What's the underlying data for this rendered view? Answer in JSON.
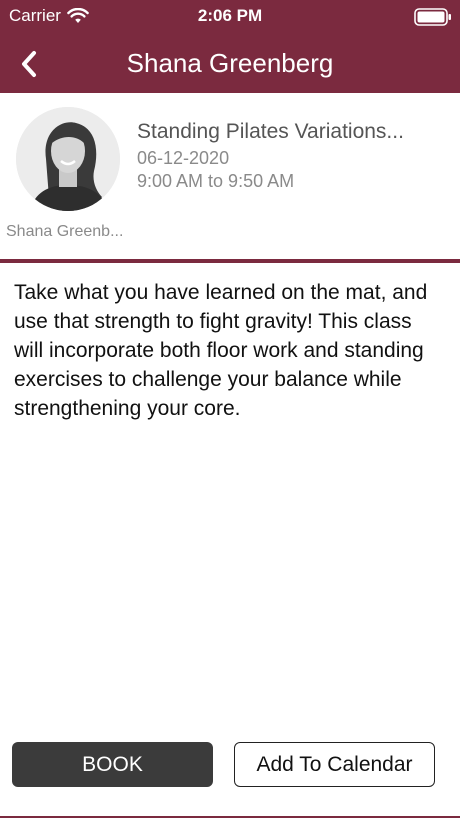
{
  "status_bar": {
    "carrier": "Carrier",
    "time": "2:06 PM"
  },
  "nav": {
    "title": "Shana Greenberg"
  },
  "class_info": {
    "title": "Standing Pilates Variations...",
    "date": "06-12-2020",
    "time": "9:00 AM to 9:50 AM",
    "instructor": "Shana Greenb..."
  },
  "description": "Take what you have learned on the mat, and use that strength to fight gravity! This class will incorporate both floor work and standing exercises to challenge your balance while strengthening your core.",
  "actions": {
    "book_label": "BOOK",
    "calendar_label": "Add To Calendar"
  },
  "colors": {
    "brand": "#7b2a3f",
    "button_dark": "#3b3b3b"
  },
  "icons": {
    "wifi": "wifi-icon",
    "battery": "battery-icon",
    "back": "chevron-left-icon"
  }
}
